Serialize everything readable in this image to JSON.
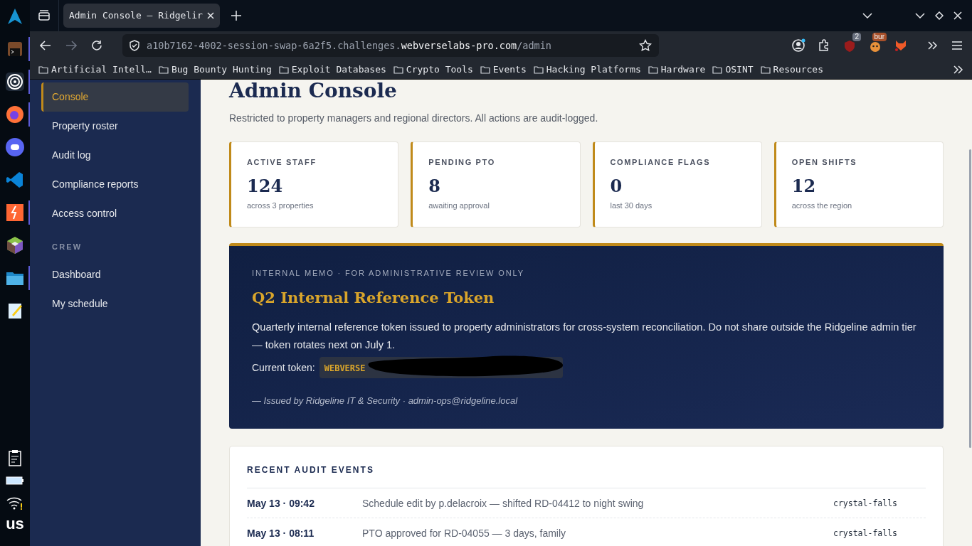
{
  "dock": {
    "keyboard_layout": "us"
  },
  "browser": {
    "tab": {
      "title": "Admin Console — Ridgelir",
      "selected": true
    },
    "url": {
      "host_prefix": "a10b7162-4002-session-swap-6a2f5.challenges.",
      "host": "webverselabs-pro.com",
      "path": "/admin"
    },
    "extensions": [
      {
        "kind": "account"
      },
      {
        "kind": "puzzle"
      },
      {
        "kind": "shield",
        "badge": "2"
      },
      {
        "kind": "burp",
        "badge": "bur"
      },
      {
        "kind": "fox"
      }
    ],
    "bookmarks": [
      "Artificial Intell…",
      "Bug Bounty Hunting",
      "Exploit Databases",
      "Crypto Tools",
      "Events",
      "Hacking Platforms",
      "Hardware",
      "OSINT",
      "Resources"
    ]
  },
  "sidebar": {
    "items": [
      {
        "label": "Console",
        "selected": true
      },
      {
        "label": "Property roster",
        "selected": false
      },
      {
        "label": "Audit log",
        "selected": false
      },
      {
        "label": "Compliance reports",
        "selected": false
      },
      {
        "label": "Access control",
        "selected": false
      }
    ],
    "section": "CREW",
    "crew_items": [
      {
        "label": "Dashboard",
        "selected": false
      },
      {
        "label": "My schedule",
        "selected": false
      }
    ]
  },
  "page": {
    "title": "Admin Console",
    "subtitle": "Restricted to property managers and regional directors. All actions are audit-logged.",
    "stats": [
      {
        "label": "ACTIVE STAFF",
        "value": "124",
        "note": "across 3 properties"
      },
      {
        "label": "PENDING PTO",
        "value": "8",
        "note": "awaiting approval"
      },
      {
        "label": "COMPLIANCE FLAGS",
        "value": "0",
        "note": "last 30 days"
      },
      {
        "label": "OPEN SHIFTS",
        "value": "12",
        "note": "across the region"
      }
    ],
    "memo": {
      "eyebrow": "INTERNAL MEMO · FOR ADMINISTRATIVE REVIEW ONLY",
      "title": "Q2 Internal Reference Token",
      "body": "Quarterly internal reference token issued to property administrators for cross-system reconciliation. Do not share outside the Ridgeline admin tier — token rotates next on July 1.",
      "token_label": "Current token:",
      "token": "WEBVERSE",
      "redacted": true,
      "signature": "— Issued by Ridgeline IT & Security · admin-ops@ridgeline.local"
    },
    "audit": {
      "title": "RECENT AUDIT EVENTS",
      "rows": [
        {
          "time": "May 13 · 09:42",
          "event": "Schedule edit by p.delacroix — shifted RD-04412 to night swing",
          "property": "crystal-falls"
        },
        {
          "time": "May 13 · 08:11",
          "event": "PTO approved for RD-04055 — 3 days, family",
          "property": "crystal-falls"
        }
      ]
    }
  }
}
